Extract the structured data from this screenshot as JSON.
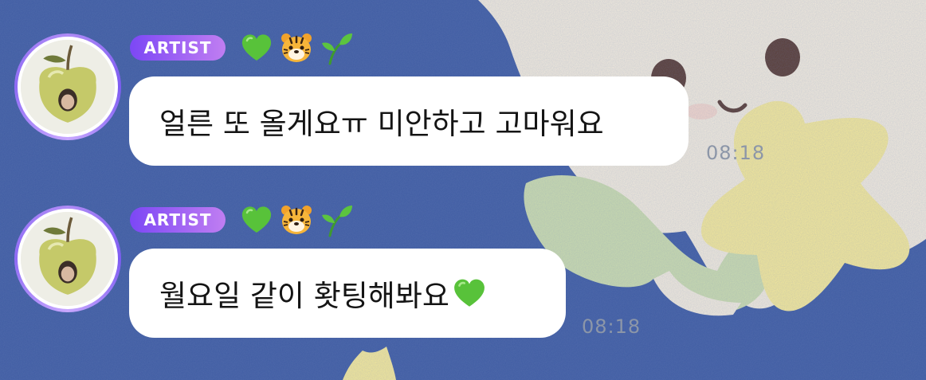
{
  "background": {
    "color": "#3f5ca3",
    "accent_colors": [
      "#f3ecde",
      "#cfe1b3",
      "#f6eb9a"
    ]
  },
  "messages": [
    {
      "sender_badge": "ARTIST",
      "emojis": [
        "green-heart-icon",
        "tiger-face-icon",
        "seedling-icon"
      ],
      "text": "얼른 또 올게요ㅠ 미안하고 고마워요",
      "time": "08:18"
    },
    {
      "sender_badge": "ARTIST",
      "emojis": [
        "green-heart-icon",
        "tiger-face-icon",
        "seedling-icon"
      ],
      "text": "월요일 같이 홧팅해봐요",
      "trailing_emoji": "green-heart-icon",
      "time": "08:18"
    }
  ],
  "colors": {
    "badge_start": "#7c47f5",
    "badge_end": "#c07ef2",
    "bubble": "#ffffff",
    "timestamp": "#8c96a8"
  }
}
